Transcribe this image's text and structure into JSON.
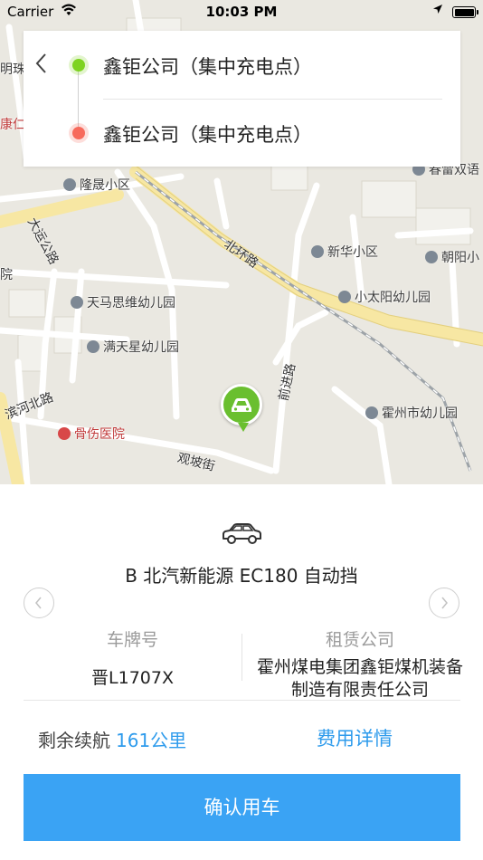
{
  "status_bar": {
    "carrier": "Carrier",
    "time": "10:03 PM"
  },
  "route": {
    "start": "鑫钜公司（集中充电点）",
    "end": "鑫钜公司（集中充电点）"
  },
  "map": {
    "pois": [
      "隆晟小区",
      "新华小区",
      "朝阳小",
      "小太阳幼儿园",
      "天马思维幼儿园",
      "满天星幼儿园",
      "霍州市幼儿园",
      "骨伤医院",
      "春雷双语"
    ],
    "roads": [
      "北环路",
      "大运公路",
      "前进路",
      "滨河北路",
      "观坡街"
    ],
    "edge_labels": [
      "明珠",
      "康仁",
      "院"
    ]
  },
  "car": {
    "name": "B 北汽新能源 EC180 自动挡",
    "plate_label": "车牌号",
    "plate_value": "晋L1707X",
    "company_label": "租赁公司",
    "company_value": "霍州煤电集团鑫钜煤机装备制造有限责任公司",
    "range_label": "剩余续航",
    "range_value": "161公里",
    "fee_link": "费用详情"
  },
  "actions": {
    "confirm": "确认用车"
  },
  "colors": {
    "accent": "#3aa3f4",
    "start_dot": "#7ed321",
    "end_dot": "#f76a5c",
    "marker": "#6abf2f"
  }
}
